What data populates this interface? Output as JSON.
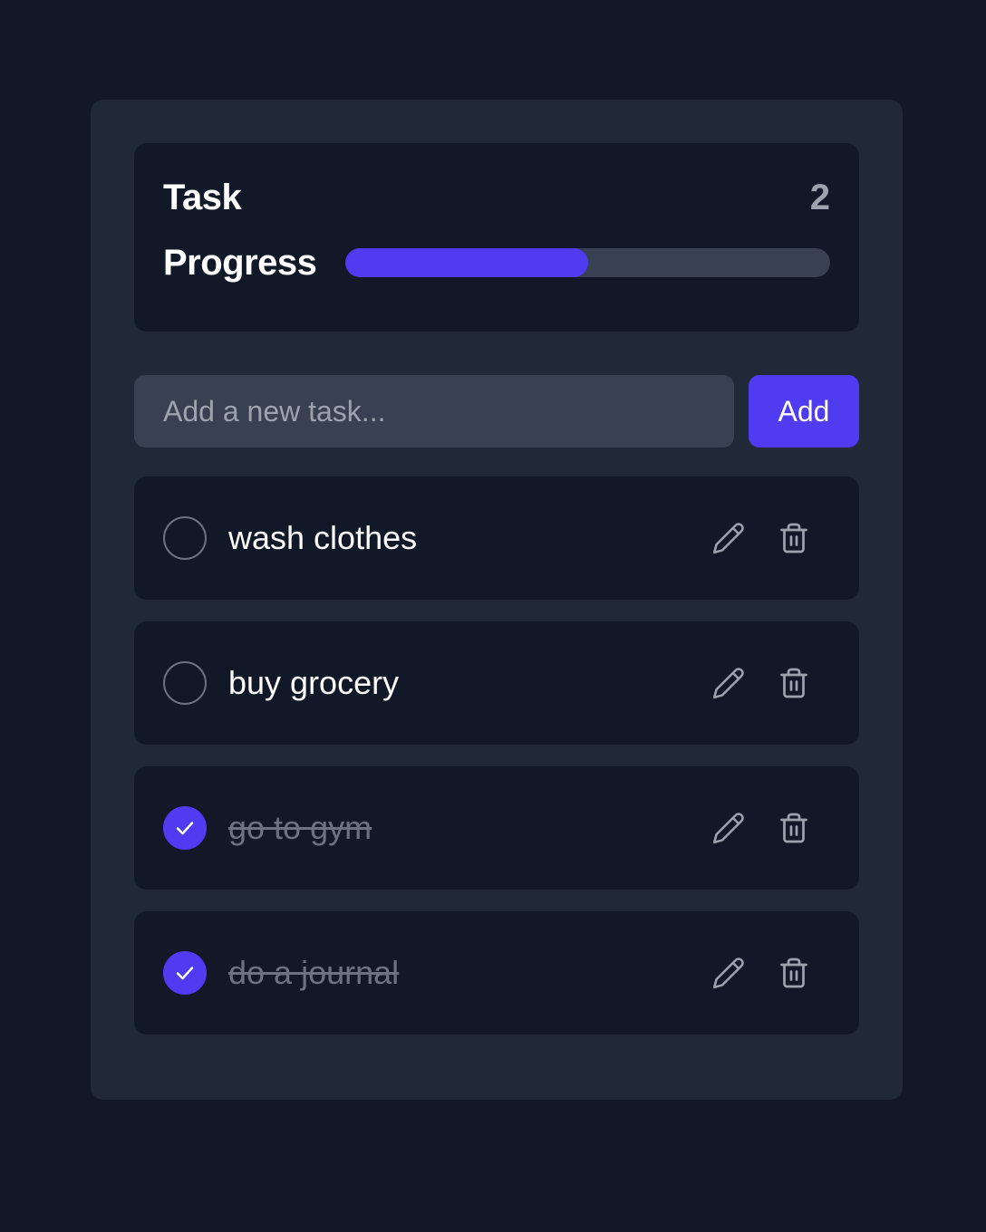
{
  "progress": {
    "title_line1": "Task",
    "title_line2": "Progress",
    "count": "2",
    "completed_fraction": 0.5
  },
  "add_task": {
    "placeholder": "Add a new task...",
    "value": "",
    "button_label": "Add"
  },
  "tasks": [
    {
      "text": "wash clothes",
      "done": false
    },
    {
      "text": "buy grocery",
      "done": false
    },
    {
      "text": "go to gym",
      "done": true
    },
    {
      "text": "do a journal",
      "done": true
    }
  ],
  "icons": {
    "edit": "pencil-icon",
    "delete": "trash-icon",
    "check": "checkmark-icon"
  },
  "colors": {
    "background": "#111827",
    "panel": "#1f2937",
    "card": "#111827",
    "accent": "#4f3cf0",
    "input": "#374151",
    "muted": "#6b7280"
  }
}
